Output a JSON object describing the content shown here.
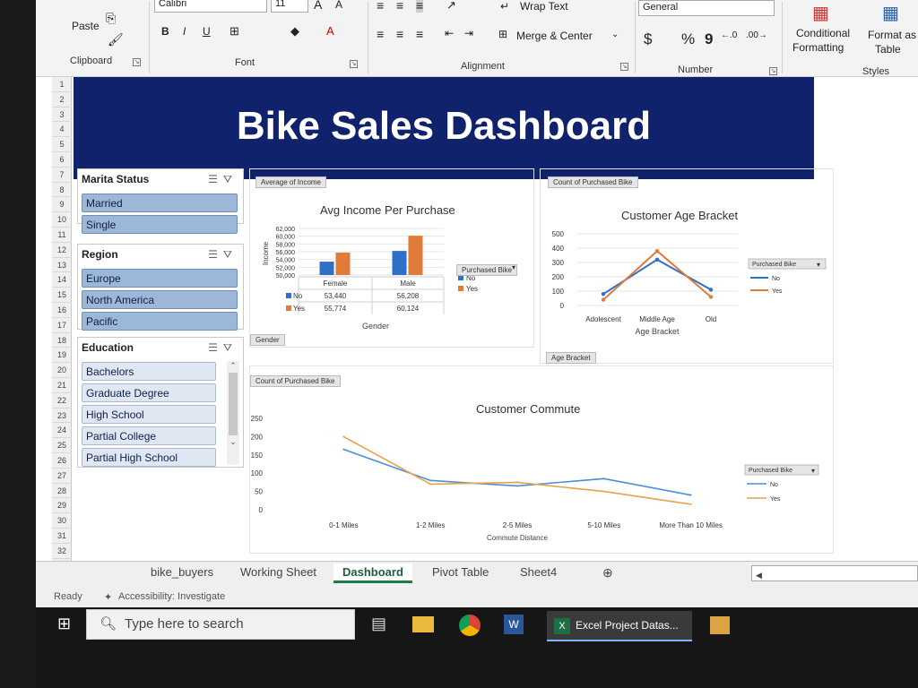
{
  "ribbon": {
    "font_name": "Calibri",
    "font_size": "11",
    "paste": "Paste",
    "bold": "B",
    "italic": "I",
    "underline": "U",
    "wrap_text": "Wrap Text",
    "merge_center": "Merge & Center",
    "number_format": "General",
    "currency": "$",
    "percent": "%",
    "comma": "9",
    "conditional": "Conditional",
    "formatting": "Formatting",
    "format_as": "Format as",
    "table": "Table",
    "groups": [
      "Clipboard",
      "Font",
      "Alignment",
      "Number",
      "Styles"
    ]
  },
  "rows": [
    "1",
    "2",
    "3",
    "4",
    "5",
    "6",
    "7",
    "8",
    "9",
    "10",
    "11",
    "12",
    "13",
    "14",
    "15",
    "16",
    "17",
    "18",
    "19",
    "20",
    "21",
    "22",
    "23",
    "24",
    "25",
    "26",
    "27",
    "28",
    "29",
    "30",
    "31",
    "32"
  ],
  "dashboard": {
    "title": "Bike Sales Dashboard"
  },
  "slicers": {
    "marital": {
      "title": "Marita Status",
      "items": [
        "Married",
        "Single"
      ]
    },
    "region": {
      "title": "Region",
      "items": [
        "Europe",
        "North America",
        "Pacific"
      ]
    },
    "education": {
      "title": "Education",
      "items": [
        "Bachelors",
        "Graduate Degree",
        "High School",
        "Partial College",
        "Partial High School"
      ]
    }
  },
  "income_chart": {
    "tag": "Average of Income",
    "title": "Avg Income Per Purchase",
    "ylabel": "Income",
    "yticks": [
      "62,000",
      "60,000",
      "58,000",
      "56,000",
      "54,000",
      "52,000",
      "50,000"
    ],
    "columns": [
      "Female",
      "Male"
    ],
    "rows": [
      {
        "label": "No",
        "values": [
          "53,440",
          "56,208"
        ]
      },
      {
        "label": "Yes",
        "values": [
          "55,774",
          "60,124"
        ]
      }
    ],
    "xlabel": "Gender",
    "legend_title": "Purchased Bike",
    "legend": [
      "No",
      "Yes"
    ],
    "gender_filter": "Gender"
  },
  "age_chart": {
    "tag": "Count of Purchased Bike",
    "title": "Customer Age Bracket",
    "yticks": [
      "500",
      "400",
      "300",
      "200",
      "100",
      "0"
    ],
    "categories": [
      "Adolescent",
      "Middle Age",
      "Old"
    ],
    "xlabel": "Age Bracket",
    "legend_title": "Purchased Bike",
    "legend": [
      "No",
      "Yes"
    ],
    "filter": "Age Bracket"
  },
  "commute_chart": {
    "tag": "Count of Purchased Bike",
    "title": "Customer Commute",
    "yticks": [
      "250",
      "200",
      "150",
      "100",
      "50",
      "0"
    ],
    "categories": [
      "0-1 Miles",
      "1-2 Miles",
      "2-5 Miles",
      "5-10 Miles",
      "More Than 10 Miles"
    ],
    "xlabel": "Commute Distance",
    "legend_title": "Purchased Bike",
    "legend": [
      "No",
      "Yes"
    ]
  },
  "chart_data": [
    {
      "type": "bar",
      "title": "Avg Income Per Purchase",
      "categories": [
        "Female",
        "Male"
      ],
      "series": [
        {
          "name": "No",
          "values": [
            53440,
            56208
          ]
        },
        {
          "name": "Yes",
          "values": [
            55774,
            60124
          ]
        }
      ],
      "xlabel": "Gender",
      "ylabel": "Income",
      "ylim": [
        50000,
        62000
      ],
      "colors": [
        "#2f6fc7",
        "#e07b39"
      ]
    },
    {
      "type": "line",
      "title": "Customer Age Bracket",
      "categories": [
        "Adolescent",
        "Middle Age",
        "Old"
      ],
      "series": [
        {
          "name": "No",
          "values": [
            80,
            320,
            110
          ]
        },
        {
          "name": "Yes",
          "values": [
            40,
            380,
            60
          ]
        }
      ],
      "xlabel": "Age Bracket",
      "ylim": [
        0,
        500
      ],
      "colors": [
        "#2f6fc7",
        "#e07b39"
      ]
    },
    {
      "type": "line",
      "title": "Customer Commute",
      "categories": [
        "0-1 Miles",
        "1-2 Miles",
        "2-5 Miles",
        "5-10 Miles",
        "More Than 10 Miles"
      ],
      "series": [
        {
          "name": "No",
          "values": [
            165,
            80,
            65,
            85,
            40
          ]
        },
        {
          "name": "Yes",
          "values": [
            200,
            70,
            75,
            50,
            15
          ]
        }
      ],
      "xlabel": "Commute Distance",
      "ylim": [
        0,
        250
      ],
      "colors": [
        "#4a8fd6",
        "#e8a24a"
      ]
    }
  ],
  "sheet_tabs": [
    "bike_buyers",
    "Working Sheet",
    "Dashboard",
    "Pivot Table",
    "Sheet4"
  ],
  "status": {
    "ready": "Ready",
    "accessibility": "Accessibility: Investigate"
  },
  "taskbar": {
    "search_placeholder": "Type here to search",
    "excel_window": "Excel Project Datas..."
  }
}
